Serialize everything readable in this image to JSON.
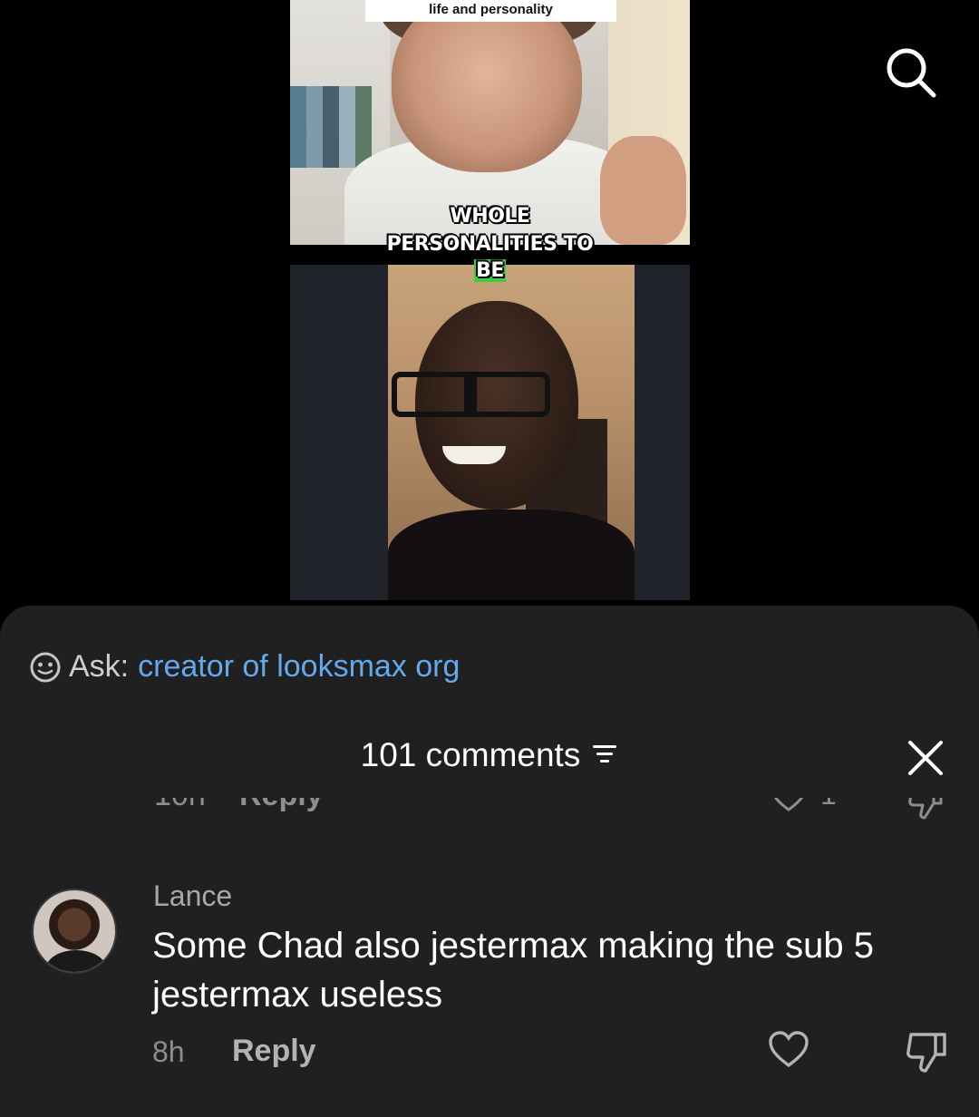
{
  "video": {
    "caption_top": "life and personality",
    "subtitle": {
      "line1": "WHOLE",
      "line2": "PERSONALITIES TO",
      "line3_highlight": "BE"
    }
  },
  "icons": {
    "search": "search-icon",
    "ask": "smiley-icon",
    "filter": "filter-icon",
    "close": "close-icon",
    "like": "heart-icon",
    "dislike": "thumbs-down-icon"
  },
  "ask": {
    "label": "Ask:",
    "query": "creator of looksmax org"
  },
  "comments": {
    "title": "101 comments"
  },
  "partial_comment": {
    "time": "10h",
    "reply": "Reply",
    "likes": "1"
  },
  "comment": {
    "author": "Lance",
    "text": "Some Chad also jestermax making the sub 5 jestermax useless",
    "time": "8h",
    "reply_label": "Reply"
  },
  "colors": {
    "sheet_bg": "#202020",
    "link": "#63a9ef",
    "highlight": "#35d03c"
  }
}
